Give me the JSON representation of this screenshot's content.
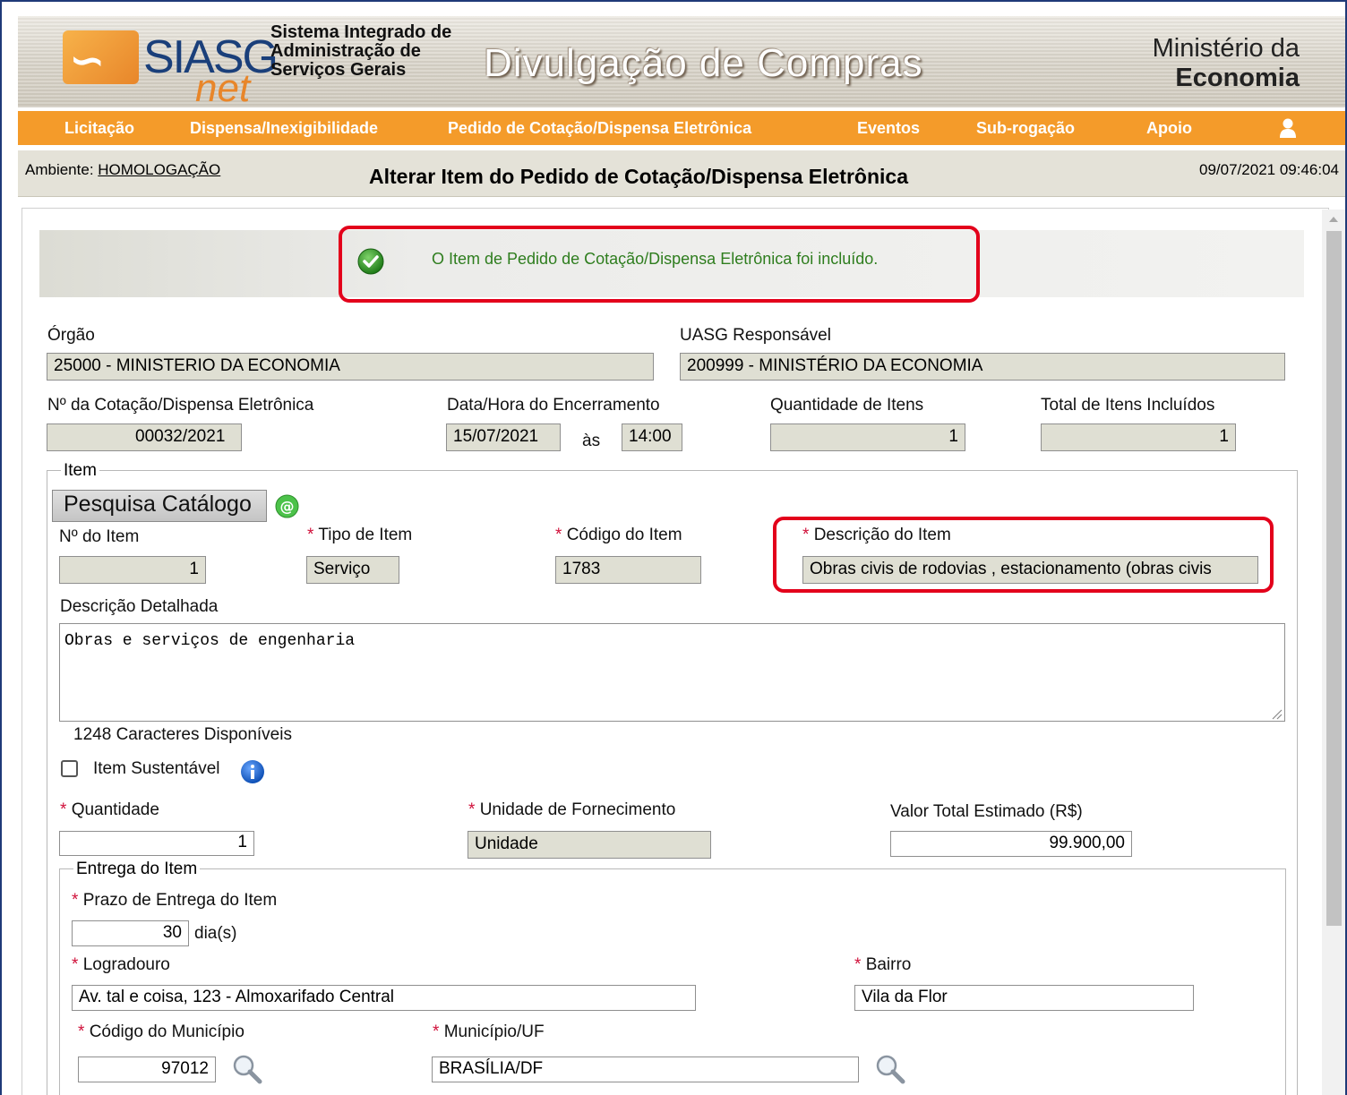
{
  "header": {
    "logo_main": "SIASG",
    "logo_sub": "net",
    "system_name_line1": "Sistema Integrado de",
    "system_name_line2": "Administração de",
    "system_name_line3": "Serviços Gerais",
    "banner_title": "Divulgação de Compras",
    "ministry_line1": "Ministério da",
    "ministry_line2": "Economia"
  },
  "nav": {
    "items": [
      "Licitação",
      "Dispensa/Inexigibilidade",
      "Pedido de Cotação/Dispensa Eletrônica",
      "Eventos",
      "Sub-rogação",
      "Apoio"
    ],
    "user_icon": "user-icon"
  },
  "ambient": {
    "label": "Ambiente:",
    "value": "HOMOLOGAÇÃO",
    "page_title": "Alterar Item do Pedido de Cotação/Dispensa Eletrônica",
    "datetime": "09/07/2021 09:46:04"
  },
  "message": {
    "text": "O Item de Pedido de Cotação/Dispensa Eletrônica foi incluído.",
    "icon": "check-circle-icon",
    "color": "#2e7d1e"
  },
  "form": {
    "orgao_label": "Órgão",
    "orgao_value": "25000 - MINISTERIO DA ECONOMIA",
    "uasg_label": "UASG Responsável",
    "uasg_value": "200999 - MINISTÉRIO DA ECONOMIA",
    "cotacao_label": "Nº da Cotação/Dispensa Eletrônica",
    "cotacao_value": "00032/2021",
    "encerramento_label": "Data/Hora do Encerramento",
    "encerramento_date": "15/07/2021",
    "as_label": "às",
    "encerramento_time": "14:00",
    "qtd_itens_label": "Quantidade de Itens",
    "qtd_itens_value": "1",
    "total_incluidos_label": "Total de Itens Incluídos",
    "total_incluidos_value": "1"
  },
  "item": {
    "legend": "Item",
    "catalog_button": "Pesquisa Catálogo",
    "num_label": "Nº do Item",
    "num_value": "1",
    "tipo_label": "Tipo de Item",
    "tipo_value": "Serviço",
    "codigo_label": "Código do Item",
    "codigo_value": "1783",
    "descricao_label": "Descrição do Item",
    "descricao_value": "Obras civis de rodovias , estacionamento (obras civis",
    "detalhada_label": "Descrição Detalhada",
    "detalhada_value": "Obras e serviços de engenharia",
    "chars_count": "1248",
    "chars_label": "Caracteres Disponíveis",
    "sustentavel_label": "Item Sustentável",
    "quantidade_label": "Quantidade",
    "quantidade_value": "1",
    "unidade_label": "Unidade de Fornecimento",
    "unidade_value": "Unidade",
    "valor_label": "Valor Total Estimado (R$)",
    "valor_value": "99.900,00"
  },
  "entrega": {
    "legend": "Entrega do Item",
    "prazo_label": "Prazo de Entrega do Item",
    "prazo_value": "30",
    "prazo_unit": "dia(s)",
    "logradouro_label": "Logradouro",
    "logradouro_value": "Av. tal e coisa, 123 - Almoxarifado Central",
    "bairro_label": "Bairro",
    "bairro_value": "Vila da Flor",
    "cod_municipio_label": "Código do Município",
    "cod_municipio_value": "97012",
    "municipio_label": "Município/UF",
    "municipio_value": "BRASÍLIA/DF"
  },
  "required_mark": "*",
  "colors": {
    "nav_orange": "#f49b2a",
    "highlight_red": "#e3001b",
    "required_red": "#d0103a",
    "readonly_field": "#dfdfd3"
  }
}
